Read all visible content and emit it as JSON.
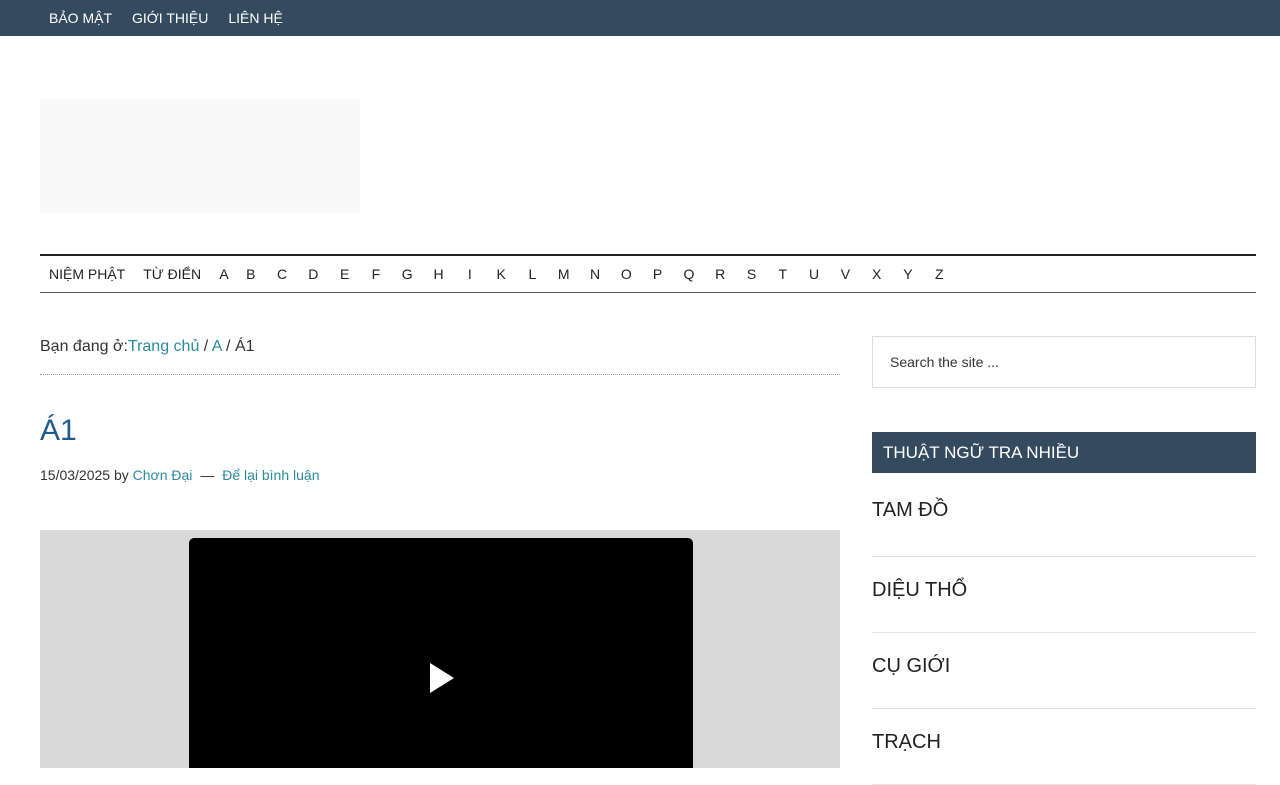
{
  "top_nav": {
    "items": [
      "BẢO MẬT",
      "GIỚI THIỆU",
      "LIÊN HỆ"
    ]
  },
  "category_nav": {
    "words": [
      "NIỆM PHẬT",
      "TỪ ĐIỂN"
    ],
    "letters": [
      "A",
      "B",
      "C",
      "D",
      "E",
      "F",
      "G",
      "H",
      "I",
      "K",
      "L",
      "M",
      "N",
      "O",
      "P",
      "Q",
      "R",
      "S",
      "T",
      "U",
      "V",
      "X",
      "Y",
      "Z"
    ]
  },
  "breadcrumb": {
    "prefix": "Bạn đang ở:",
    "home": "Trang chủ",
    "sep1": " / ",
    "category": "A",
    "sep2": " / ",
    "current": "Á1"
  },
  "post": {
    "title": "Á1",
    "date": "15/03/2025",
    "by": "by",
    "author": "Chơn Đại",
    "dash": "—",
    "comment_link": "Để lại bình luận"
  },
  "sidebar": {
    "search_placeholder": "Search the site ...",
    "widget_title": "THUẬT NGỮ TRA NHIỀU",
    "terms": [
      "TAM ĐỒ",
      "DIỆU THỔ",
      "CỤ GIỚI",
      "TRẠCH"
    ]
  },
  "colors": {
    "header_bg": "#344b5f",
    "link": "#2a8a9e",
    "title": "#1e5b8c"
  }
}
